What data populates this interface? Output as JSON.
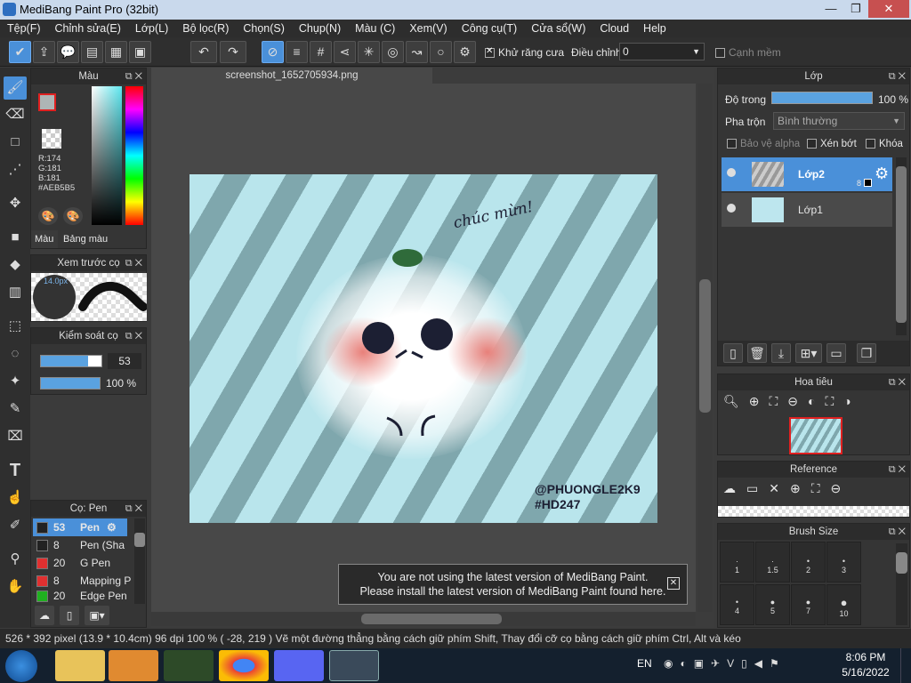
{
  "window": {
    "title": "MediBang Paint Pro (32bit)"
  },
  "menu": [
    "Tệp(F)",
    "Chỉnh sửa(E)",
    "Lớp(L)",
    "Bộ lọc(R)",
    "Chọn(S)",
    "Chụp(N)",
    "Màu (C)",
    "Xem(V)",
    "Công cụ(T)",
    "Cửa sổ(W)",
    "Cloud",
    "Help"
  ],
  "toolbar": {
    "antialias": "Khử răng cưa",
    "adjust_label": "Điều chỉnh",
    "adjust_value": "0",
    "soft_edge": "Cạnh mềm"
  },
  "color_panel": {
    "title": "Màu",
    "r": "R:174",
    "g": "G:181",
    "b": "B:181",
    "hex": "#AEB5B5",
    "tab_color": "Màu",
    "tab_palette": "Bảng màu",
    "main_color": "#AEB5B5",
    "sub_color": "#c0303a"
  },
  "preview_panel": {
    "title": "Xem trước cọ",
    "size": "14.0px"
  },
  "brush_ctrl": {
    "title": "Kiểm soát cọ",
    "size": "53",
    "opacity": "100 %"
  },
  "brush_list": {
    "title": "Cọ: Pen",
    "items": [
      {
        "size": "53",
        "name": "Pen",
        "color": "#222222",
        "selected": true
      },
      {
        "size": "8",
        "name": "Pen (Sha",
        "color": "#222222",
        "selected": false
      },
      {
        "size": "20",
        "name": "G Pen",
        "color": "#e03030",
        "selected": false
      },
      {
        "size": "8",
        "name": "Mapping P",
        "color": "#e03030",
        "selected": false
      },
      {
        "size": "20",
        "name": "Edge Pen",
        "color": "#20b020",
        "selected": false
      }
    ]
  },
  "document": {
    "tab": "screenshot_1652705934.png",
    "handwriting": "chúc mừn!",
    "signature_line1": "@PHUONGLE2K9",
    "signature_line2": "#HD247"
  },
  "notice": {
    "line1": "You are not using the latest version of MediBang Paint.",
    "line2": "Please install the latest version of MediBang Paint found here."
  },
  "layer_panel": {
    "title": "Lớp",
    "opacity_label": "Độ trong",
    "opacity_value": "100 %",
    "opacity": 1.0,
    "blend_label": "Pha trộn",
    "blend_value": "Bình thường",
    "protect_alpha": "Bảo vệ alpha",
    "clipping": "Xén bớt",
    "lock": "Khóa",
    "layers": [
      {
        "name": "Lớp2",
        "num": "8",
        "selected": true
      },
      {
        "name": "Lớp1",
        "num": "",
        "selected": false
      }
    ]
  },
  "navigator": {
    "title": "Hoa tiêu"
  },
  "reference": {
    "title": "Reference"
  },
  "brush_size": {
    "title": "Brush Size",
    "sizes": [
      "1",
      "1.5",
      "2",
      "3",
      "4",
      "5",
      "7",
      "10"
    ]
  },
  "status": {
    "text": "526 * 392 pixel   (13.9 * 10.4cm)   96 dpi   100 %   ( -28, 219 )   Vẽ một đường thẳng bằng cách giữ phím Shift, Thay đổi cỡ cọ bằng cách giữ phím Ctrl, Alt và kéo"
  },
  "taskbar": {
    "lang": "EN",
    "time": "8:06 PM",
    "date": "5/16/2022"
  }
}
